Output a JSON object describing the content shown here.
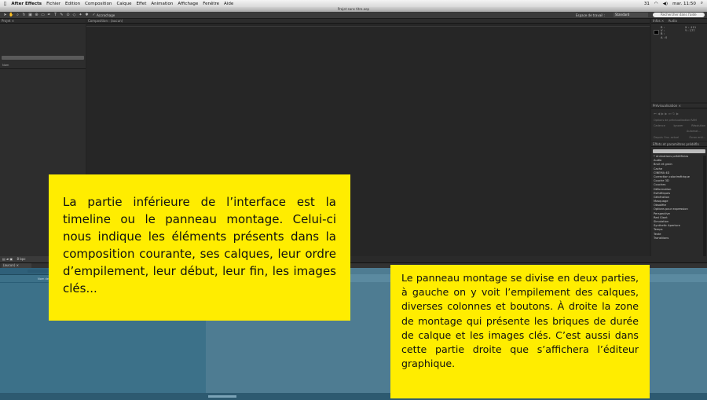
{
  "menubar": {
    "items": [
      "After Effects",
      "Fichier",
      "Edition",
      "Composition",
      "Calque",
      "Effet",
      "Animation",
      "Affichage",
      "Fenêtre",
      "Aide"
    ],
    "clock": "mar. 11:50",
    "battery": "31"
  },
  "window": {
    "title": "Projet sans titre.aep"
  },
  "toolbar": {
    "snap_label": "Accrochage",
    "workspace_label": "Espace de travail :",
    "workspace_value": "Standard",
    "help_search_placeholder": "Rechercher dans l'aide"
  },
  "project_panel": {
    "tab": "Projet ×",
    "column": "Nom",
    "bpc": "8 bpc"
  },
  "composition_panel": {
    "tab": "Composition : (aucun)"
  },
  "info_panel": {
    "tabs": [
      "Infos ×",
      "Audio"
    ],
    "r": "R :",
    "v": "V :",
    "b": "B :",
    "a": "A : 0",
    "x": "X : -111",
    "y": "Y : 177"
  },
  "preview_panel": {
    "tab": "Prévisualisation ×",
    "options_label": "Options de prévisualisation RAM",
    "rate_col": "Cadence",
    "skip_col": "Ignorer",
    "res_col": "Résolution",
    "res_value": "Automat...",
    "from_label": "Depuis l'ins. actuel",
    "fullscreen_label": "Écran enti..."
  },
  "effects_panel": {
    "tab": "Effets et paramètres prédéfin",
    "items": [
      "* Animations prédéfinies",
      "Audio",
      "Bruit et grain",
      "Cache",
      "CINEMA 4D",
      "Correction colorimétrique",
      "Couche 3D",
      "Couches",
      "Déformation",
      "Esthétiques",
      "Génération",
      "Masquage",
      "Obsolète",
      "Options pour expression",
      "Perspective",
      "Red Giant",
      "Simulation",
      "Synthetic Aperture",
      "Temps",
      "Texte",
      "Transitions"
    ]
  },
  "timeline": {
    "tab": "(aucun) ×",
    "source_label": "Nom des sources"
  },
  "notes": {
    "note1": "La partie inférieure de l’interface est la timeline ou le panneau montage. Celui-ci nous indique les éléments présents dans la composition courante, ses calques, leur ordre d’empilement, leur début, leur fin, les images clés...",
    "note2": "Le panneau montage se divise en deux parties, à gauche on y voit l’empilement des calques, diverses colonnes et boutons. À droite la zone de montage qui présente les briques de durée de calque et les images clés. C’est aussi dans cette partie droite que s’affichera l’éditeur graphique."
  },
  "colors": {
    "note_bg": "#ffed00",
    "timeline_left": "#3c7189",
    "timeline_right": "#4e7c92",
    "ui_dark": "#232323"
  }
}
